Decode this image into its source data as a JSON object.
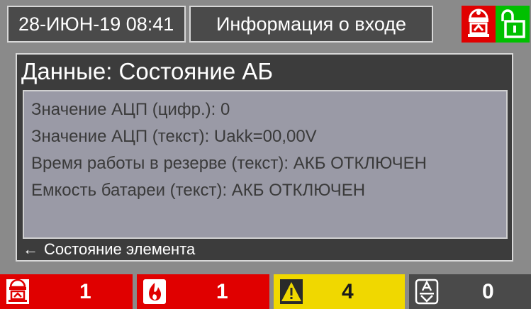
{
  "header": {
    "datetime": "28-ИЮН-19 08:41",
    "title": "Информация о входе",
    "icons": [
      "fire-alarm-icon",
      "unlocked-padlock-icon"
    ]
  },
  "panel": {
    "title": "Данные: Состояние АБ",
    "rows": [
      "Значение АЦП (цифр.): 0",
      "Значение АЦП (текст): Uakk=00,00V",
      "Время работы в резерве (текст): АКБ ОТКЛЮЧЕН",
      "Емкость батареи (текст): АКБ ОТКЛЮЧЕН"
    ],
    "footer": "Состояние элемента",
    "footer_arrow": "←"
  },
  "counters": {
    "fire": {
      "value": "1",
      "icon": "fire-alarm-icon",
      "color": "#e00000"
    },
    "flame": {
      "value": "1",
      "icon": "flame-icon",
      "color": "#e00000"
    },
    "warning": {
      "value": "4",
      "icon": "warning-triangle-icon",
      "color": "#f0d800"
    },
    "fault": {
      "value": "0",
      "icon": "fault-icon",
      "color": "#4a4a4a"
    }
  }
}
